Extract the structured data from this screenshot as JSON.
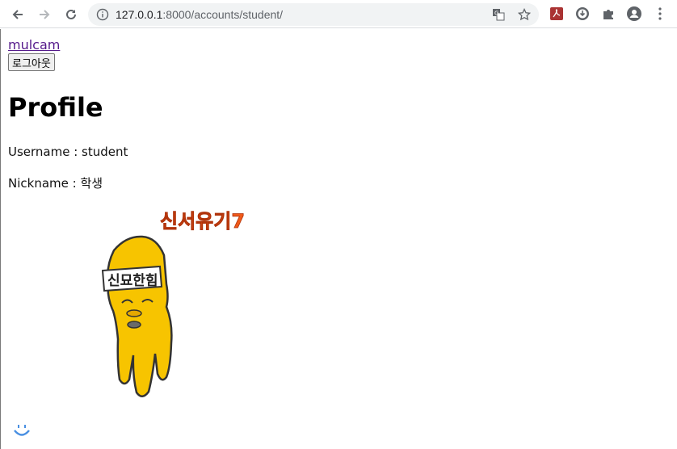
{
  "browser": {
    "url_host": "127.0.0.1",
    "url_path": ":8000/accounts/student/",
    "icons": [
      "back-icon",
      "forward-icon",
      "reload-icon",
      "info-icon",
      "translate-icon",
      "star-icon",
      "pdf-extension-icon",
      "download-extension-icon",
      "puzzle-icon",
      "account-icon",
      "menu-icon"
    ]
  },
  "page": {
    "brand_link": "mulcam",
    "logout_button": "로그아웃",
    "title": "Profile",
    "username_line": "Username : student",
    "nickname_line": "Nickname : 학생",
    "image": {
      "logo_text": "신서유기7",
      "headband_text": "신묘한힘"
    }
  },
  "colors": {
    "link": "#551a8b",
    "figure": "#f7c400"
  }
}
